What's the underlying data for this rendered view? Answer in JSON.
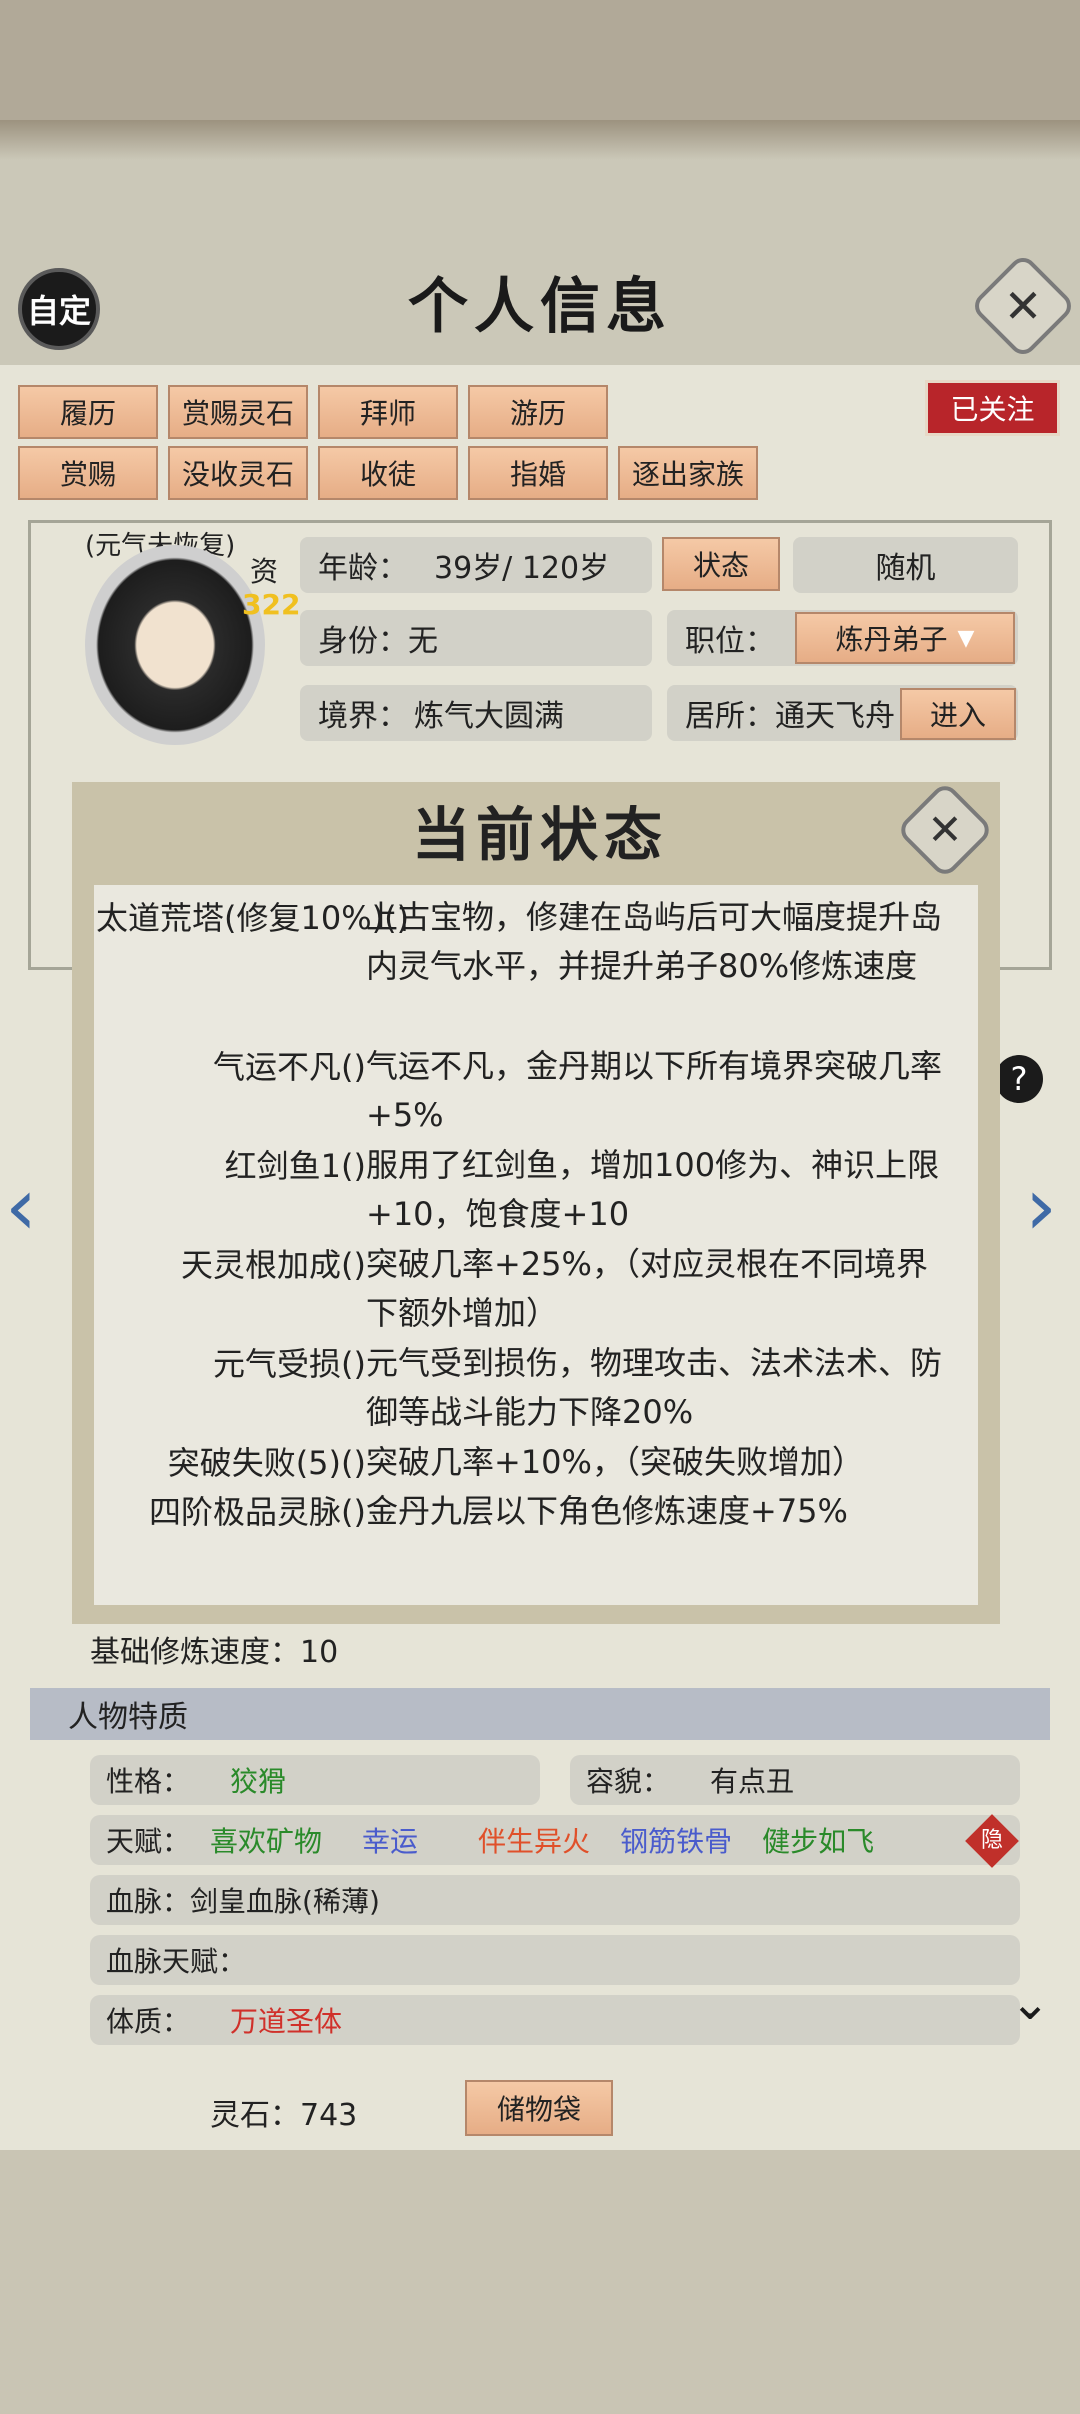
{
  "header": {
    "badge": "自定",
    "title": "个人信息",
    "close": "✕"
  },
  "actions_row1": [
    "履历",
    "赏赐灵石",
    "拜师",
    "游历"
  ],
  "actions_row2": [
    "赏赐",
    "没收灵石",
    "收徒",
    "指婚",
    "逐出家族"
  ],
  "follow_label": "已关注",
  "character": {
    "status_note": "(元气未恢复)",
    "zi_label": "资",
    "zi_value": "322",
    "age_label": "年龄：",
    "age_value": "39岁/ 120岁",
    "status_button": "状态",
    "random_button": "随机",
    "identity_label": "身份：",
    "identity_value": "无",
    "position_label": "职位：",
    "position_value": "炼丹弟子",
    "realm_label": "境界：",
    "realm_value": "炼气大圆满",
    "residence_label": "居所：",
    "residence_value": "通天飞舟",
    "enter_button": "进入"
  },
  "modal": {
    "title": "当前状态",
    "close": "✕",
    "entries": [
      {
        "name": "太道荒塔(修复10%)()",
        "desc": "上古宝物，修建在岛屿后可大幅度提升岛内灵气水平，并提升弟子80%修炼速度"
      },
      {
        "name": "气运不凡()",
        "desc": "气运不凡，金丹期以下所有境界突破几率+5%"
      },
      {
        "name": "红剑鱼1()",
        "desc": "服用了红剑鱼，增加100修为、神识上限+10，饱食度+10"
      },
      {
        "name": "天灵根加成()",
        "desc": "突破几率+25%，（对应灵根在不同境界下额外增加）"
      },
      {
        "name": "元气受损()",
        "desc": "元气受到损伤，物理攻击、法术法术、防御等战斗能力下降20%"
      },
      {
        "name": "突破失败(5)()",
        "desc": "突破几率+10%，（突破失败增加）"
      },
      {
        "name": "四阶极品灵脉()",
        "desc": "金丹九层以下角色修炼速度+75%"
      }
    ]
  },
  "base_speed": "基础修炼速度：10",
  "traits": {
    "section": "人物特质",
    "personality_label": "性格：",
    "personality_value": "狡猾",
    "appearance_label": "容貌：",
    "appearance_value": "有点丑",
    "talent_label": "天赋：",
    "talents": [
      {
        "text": "喜欢矿物",
        "color": "#2a8a2a"
      },
      {
        "text": "幸运",
        "color": "#4a5ccc"
      },
      {
        "text": "伴生异火",
        "color": "#e0502a"
      },
      {
        "text": "钢筋铁骨",
        "color": "#4a5ccc"
      },
      {
        "text": "健步如飞",
        "color": "#2a8a2a"
      }
    ],
    "hide_badge": "隐",
    "bloodline_label": "血脉：",
    "bloodline_value": "剑皇血脉(稀薄)",
    "bloodline_talent_label": "血脉天赋：",
    "physique_label": "体质：",
    "physique_value": "万道圣体"
  },
  "footer": {
    "spirit_stone": "灵石：743",
    "storage_button": "储物袋"
  }
}
